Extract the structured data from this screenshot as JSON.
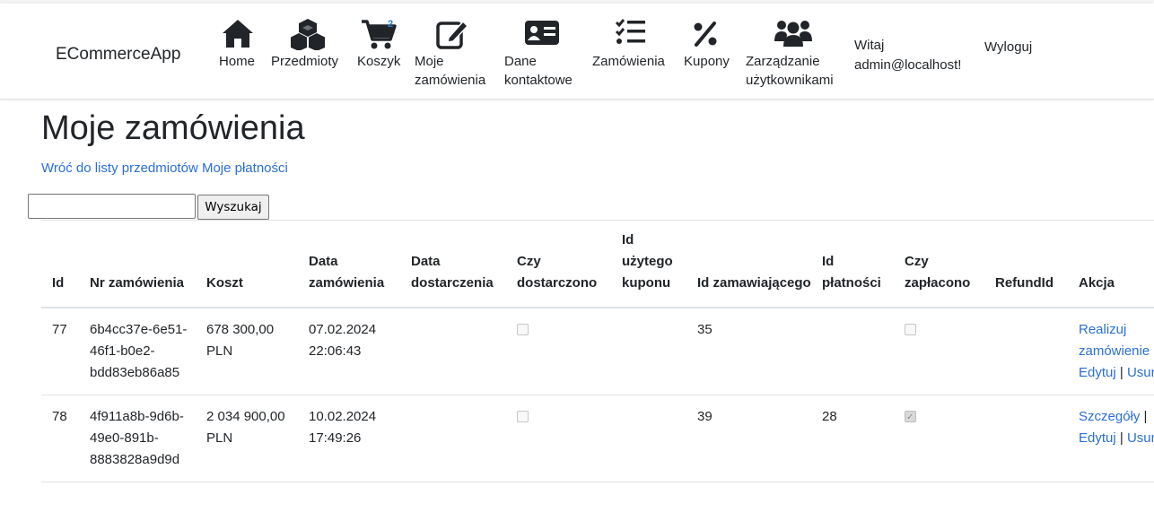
{
  "navbar": {
    "brand": "ECommerceApp",
    "items": [
      {
        "label": "Home",
        "icon": "home-icon"
      },
      {
        "label": "Przedmioty",
        "icon": "cubes-icon"
      },
      {
        "label": "Koszyk",
        "icon": "cart-icon",
        "badge": "2"
      },
      {
        "label": "Moje zamówienia",
        "icon": "edit-icon"
      },
      {
        "label": "Dane kontaktowe",
        "icon": "contact-card-icon"
      },
      {
        "label": "Zamówienia",
        "icon": "list-check-icon"
      },
      {
        "label": "Kupony",
        "icon": "percent-icon"
      },
      {
        "label": "Zarządzanie użytkownikami",
        "icon": "users-icon"
      }
    ],
    "welcome": "Witaj admin@localhost!",
    "logout": "Wyloguj"
  },
  "page": {
    "title": "Moje zamówienia",
    "link_back": "Wróć do listy przedmiotów",
    "link_payments": "Moje płatności"
  },
  "search": {
    "value": "",
    "button": "Wyszukaj"
  },
  "table": {
    "headers": [
      "Id",
      "Nr zamówienia",
      "Koszt",
      "Data zamówienia",
      "Data dostarczenia",
      "Czy dostarczono",
      "Id użytego kuponu",
      "Id zamawiającego",
      "Id płatności",
      "Czy zapłacono",
      "RefundId",
      "Akcja"
    ],
    "rows": [
      {
        "id": "77",
        "number": "6b4cc37e-6e51-46f1-b0e2-bdd83eb86a85",
        "cost": "678 300,00 PLN",
        "order_date": "07.02.2024 22:06:43",
        "delivery_date": "",
        "delivered": false,
        "coupon_id": "",
        "customer_id": "35",
        "payment_id": "",
        "paid": false,
        "refund_id": "",
        "actions": [
          "Realizuj zamówienie",
          "Edytuj",
          "Usuń"
        ]
      },
      {
        "id": "78",
        "number": "4f911a8b-9d6b-49e0-891b-8883828a9d9d",
        "cost": "2 034 900,00 PLN",
        "order_date": "10.02.2024 17:49:26",
        "delivery_date": "",
        "delivered": false,
        "coupon_id": "",
        "customer_id": "39",
        "payment_id": "28",
        "paid": true,
        "refund_id": "",
        "actions": [
          "Szczegóły",
          "Edytuj",
          "Usuń"
        ]
      }
    ]
  },
  "colors": {
    "link": "#2a6fd6",
    "text": "#212529",
    "border": "#dee2e6",
    "badge": "#2a7bd6"
  }
}
